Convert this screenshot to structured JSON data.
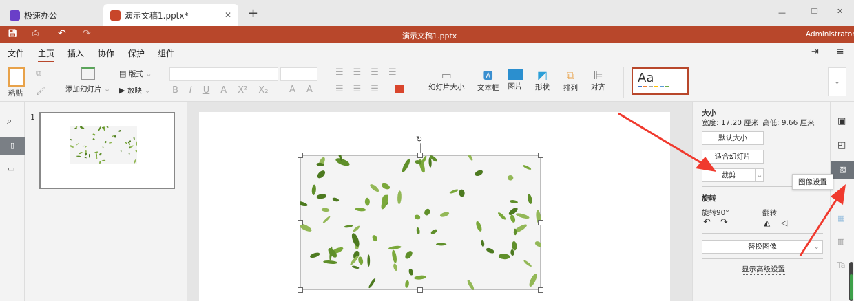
{
  "tabs": [
    {
      "label": "极速办公"
    },
    {
      "label": "演示文稿1.pptx*"
    }
  ],
  "window_title": "演示文稿1.pptx",
  "user": "Administrator",
  "menu": [
    "文件",
    "主页",
    "插入",
    "协作",
    "保护",
    "组件"
  ],
  "ribbon": {
    "paste": "粘贴",
    "add_slide": "添加幻灯片",
    "layout": "版式",
    "play": "放映",
    "slide_size": "幻灯片大小",
    "textbox": "文本框",
    "image": "图片",
    "shape": "形状",
    "arrange": "排列",
    "align": "对齐",
    "theme": "Aa",
    "font_buttons": [
      "B",
      "I",
      "U",
      "A",
      "X²",
      "X₂"
    ]
  },
  "thumbnail": {
    "number": "1"
  },
  "panel": {
    "size_title": "大小",
    "width": "宽度: 17.20 厘米",
    "height": "高低: 9.66 厘米",
    "default_size": "默认大小",
    "fit_slide": "适合幻灯片",
    "crop": "裁剪",
    "rotate_title": "旋转",
    "rotate90": "旋转90°",
    "flip": "翻转",
    "replace": "替换图像",
    "advanced": "显示高级设置"
  },
  "tooltip": "图像设置",
  "colors": {
    "accent": "#b8472b",
    "arrow": "#f03a2e"
  }
}
